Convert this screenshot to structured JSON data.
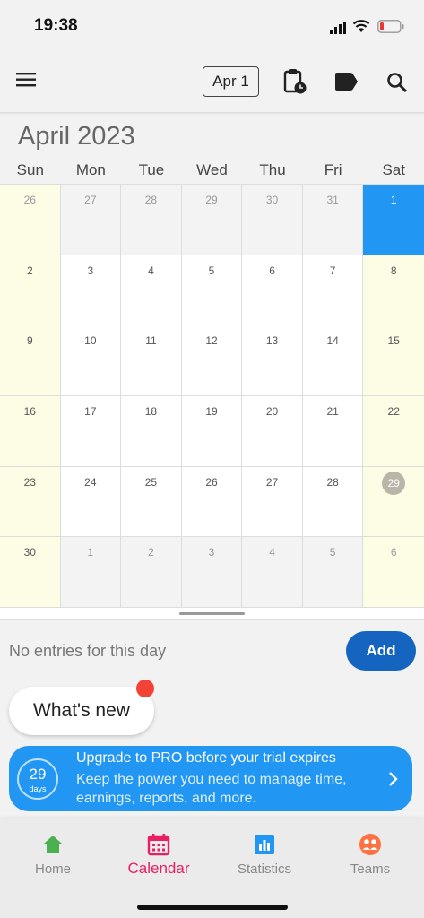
{
  "status_bar": {
    "time": "19:38"
  },
  "toolbar": {
    "date_chip": "Apr 1"
  },
  "calendar": {
    "month_title": "April 2023",
    "weekdays": [
      "Sun",
      "Mon",
      "Tue",
      "Wed",
      "Thu",
      "Fri",
      "Sat"
    ],
    "days": [
      {
        "num": "26",
        "outside": true
      },
      {
        "num": "27",
        "outside": true
      },
      {
        "num": "28",
        "outside": true
      },
      {
        "num": "29",
        "outside": true
      },
      {
        "num": "30",
        "outside": true
      },
      {
        "num": "31",
        "outside": true
      },
      {
        "num": "1",
        "selected": true
      },
      {
        "num": "2"
      },
      {
        "num": "3"
      },
      {
        "num": "4"
      },
      {
        "num": "5"
      },
      {
        "num": "6"
      },
      {
        "num": "7"
      },
      {
        "num": "8"
      },
      {
        "num": "9"
      },
      {
        "num": "10"
      },
      {
        "num": "11"
      },
      {
        "num": "12"
      },
      {
        "num": "13"
      },
      {
        "num": "14"
      },
      {
        "num": "15"
      },
      {
        "num": "16"
      },
      {
        "num": "17"
      },
      {
        "num": "18"
      },
      {
        "num": "19"
      },
      {
        "num": "20"
      },
      {
        "num": "21"
      },
      {
        "num": "22"
      },
      {
        "num": "23"
      },
      {
        "num": "24"
      },
      {
        "num": "25"
      },
      {
        "num": "26"
      },
      {
        "num": "27"
      },
      {
        "num": "28"
      },
      {
        "num": "29",
        "today": true
      },
      {
        "num": "30"
      },
      {
        "num": "1",
        "outside": true
      },
      {
        "num": "2",
        "outside": true
      },
      {
        "num": "3",
        "outside": true
      },
      {
        "num": "4",
        "outside": true
      },
      {
        "num": "5",
        "outside": true
      },
      {
        "num": "6",
        "outside": true
      }
    ]
  },
  "entries": {
    "empty_text": "No entries for this day",
    "add_label": "Add"
  },
  "whats_new": {
    "label": "What's new"
  },
  "promo": {
    "days_number": "29",
    "days_label": "days",
    "title": "Upgrade to PRO before your trial expires",
    "body": "Keep the power you need to manage time, earnings, reports, and more."
  },
  "bottom_nav": {
    "items": [
      {
        "label": "Home"
      },
      {
        "label": "Calendar"
      },
      {
        "label": "Statistics"
      },
      {
        "label": "Teams"
      }
    ]
  },
  "colors": {
    "accent": "#2196f3",
    "active_nav": "#e91e63",
    "add_button": "#1565c0",
    "home_icon": "#4caf50",
    "teams_icon": "#ff7043",
    "weekend_bg": "#fdfde6"
  }
}
